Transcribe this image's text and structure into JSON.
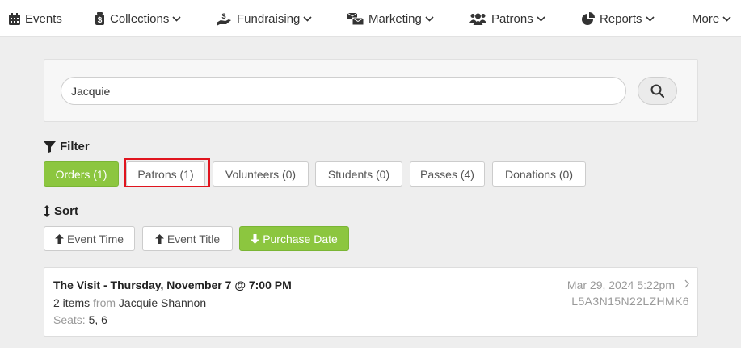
{
  "nav": {
    "events": "Events",
    "collections": "Collections",
    "fundraising": "Fundraising",
    "marketing": "Marketing",
    "patrons": "Patrons",
    "reports": "Reports",
    "more": "More"
  },
  "search": {
    "value": "Jacquie"
  },
  "filter": {
    "title": "Filter",
    "buttons": {
      "orders": "Orders (1)",
      "patrons": "Patrons (1)",
      "volunteers": "Volunteers (0)",
      "students": "Students (0)",
      "passes": "Passes (4)",
      "donations": "Donations (0)"
    },
    "active": "orders"
  },
  "sort": {
    "title": "Sort",
    "buttons": {
      "event_time": "Event Time",
      "event_title": "Event Title",
      "purchase_date": "Purchase Date"
    },
    "active": "purchase_date"
  },
  "order": {
    "title": "The Visit - Thursday, November 7 @ 7:00 PM",
    "items": "2 items",
    "from_label": "from",
    "customer": "Jacquie Shannon",
    "seats_label": "Seats:",
    "seats": "5, 6",
    "date": "Mar 29, 2024 5:22pm",
    "code": "L5A3N15N22LZHMK6"
  },
  "colors": {
    "accent": "#8cc63f",
    "highlight": "#e0141e"
  }
}
